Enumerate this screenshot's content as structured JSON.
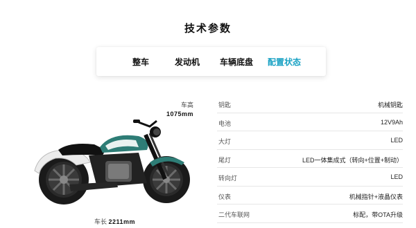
{
  "page": {
    "title": "技术参数"
  },
  "tabs": [
    {
      "label": "整车"
    },
    {
      "label": "发动机"
    },
    {
      "label": "车辆底盘"
    },
    {
      "label": "配置状态"
    }
  ],
  "active_tab": "配置状态",
  "colors": {
    "accent": "#1aa2c4",
    "tank": "#2e7d76",
    "tank_light": "#e9f2f0",
    "frame": "#1a1a1a"
  },
  "dimensions": {
    "height_label": "车高",
    "height_value": "1075mm",
    "length_label": "车长",
    "length_value": "2211mm"
  },
  "specs": [
    {
      "label": "钥匙",
      "value": "机械钥匙"
    },
    {
      "label": "电池",
      "value": "12V9Ah"
    },
    {
      "label": "大灯",
      "value": "LED"
    },
    {
      "label": "尾灯",
      "value": "LED一体集成式（转向+位置+制动）"
    },
    {
      "label": "转向灯",
      "value": "LED"
    },
    {
      "label": "仪表",
      "value": "机械指针+液晶仪表"
    },
    {
      "label": "二代车联网",
      "value": "标配，带OTA升级"
    }
  ]
}
